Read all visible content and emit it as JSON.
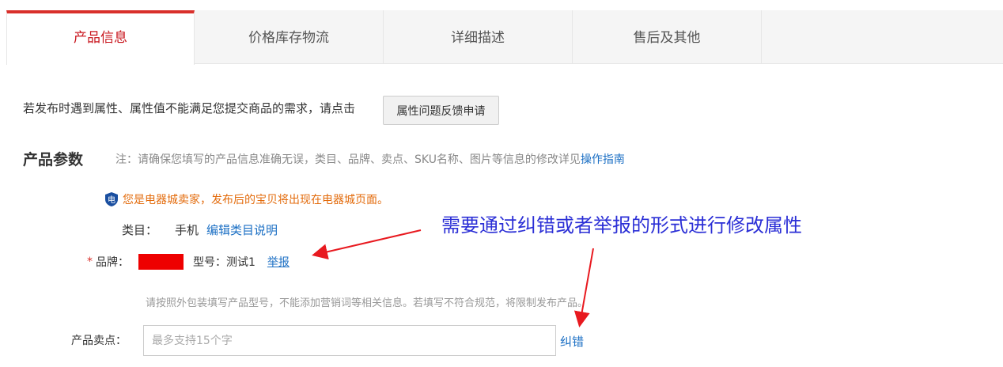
{
  "tabs": [
    {
      "label": "产品信息",
      "active": true
    },
    {
      "label": "价格库存物流",
      "active": false
    },
    {
      "label": "详细描述",
      "active": false
    },
    {
      "label": "售后及其他",
      "active": false
    }
  ],
  "tip": {
    "text": "若发布时遇到属性、属性值不能满足您提交商品的需求，请点击",
    "button_label": "属性问题反馈申请"
  },
  "params": {
    "title": "产品参数",
    "note": "注：请确保您填写的产品信息准确无误，类目、品牌、卖点、SKU名称、图片等信息的修改详见",
    "guide_link": "操作指南"
  },
  "mall_notice": {
    "badge_text": "电",
    "text": "您是电器城卖家，发布后的宝贝将出现在电器城页面。"
  },
  "category": {
    "label": "类目：",
    "value": "手机",
    "link": "编辑类目说明"
  },
  "brand": {
    "required_mark": "*",
    "label": "品牌：",
    "model_label": "型号：测试1",
    "report_link": "举报"
  },
  "hint": "请按照外包装填写产品型号，不能添加营销词等相关信息。若填写不符合规范，将限制发布产品。",
  "selling_point": {
    "label": "产品卖点：",
    "placeholder": "最多支持15个字",
    "value": "",
    "correct_link": "纠错"
  },
  "annotation": "需要通过纠错或者举报的形式进行修改属性",
  "colors": {
    "accent_red": "#d9302b",
    "link_blue": "#1b6fc4",
    "notice_orange": "#e36b0c",
    "annotation_blue": "#2b2fd6",
    "arrow_red": "#e8191f"
  }
}
